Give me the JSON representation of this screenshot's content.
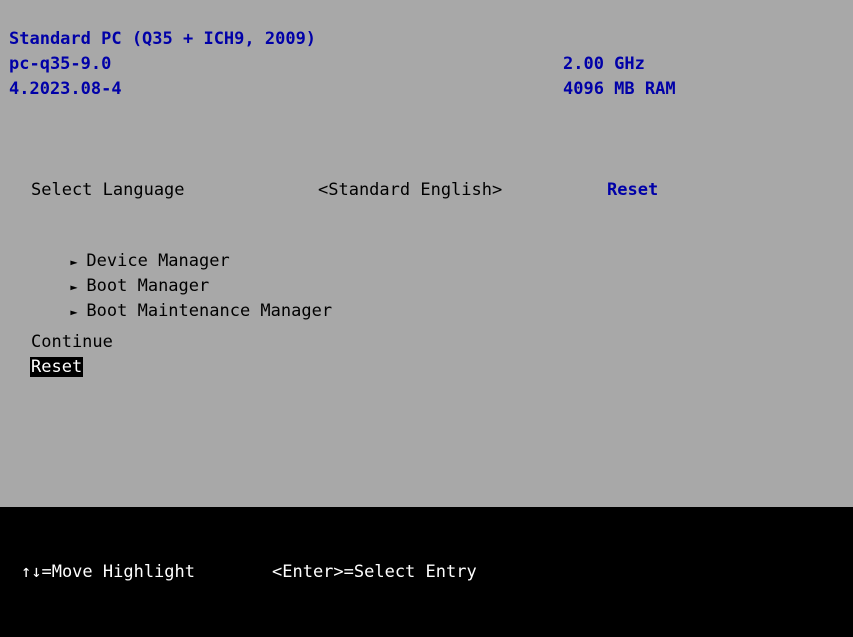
{
  "system_info": {
    "machine": "Standard PC (Q35 + ICH9, 2009)",
    "version": "pc-q35-9.0",
    "firmware": "4.2023.08-4",
    "cpu_speed": "2.00 GHz",
    "ram": "4096 MB RAM"
  },
  "language": {
    "label": "Select Language",
    "value": "<Standard English>",
    "reset_label": "Reset"
  },
  "menu": {
    "arrow_glyph": "►",
    "items": [
      {
        "label": "Device Manager"
      },
      {
        "label": "Boot Manager"
      },
      {
        "label": "Boot Maintenance Manager"
      }
    ]
  },
  "actions": {
    "continue_label": "Continue",
    "reset_label": "Reset",
    "selected": "Reset"
  },
  "footer": {
    "move_help": "↑↓=Move Highlight",
    "enter_help": "<Enter>=Select Entry"
  },
  "colors": {
    "background": "#a8a8a8",
    "info_text": "#0000a8",
    "footer_bg": "#000000",
    "highlight_bg": "#000000",
    "highlight_fg": "#ffffff"
  }
}
